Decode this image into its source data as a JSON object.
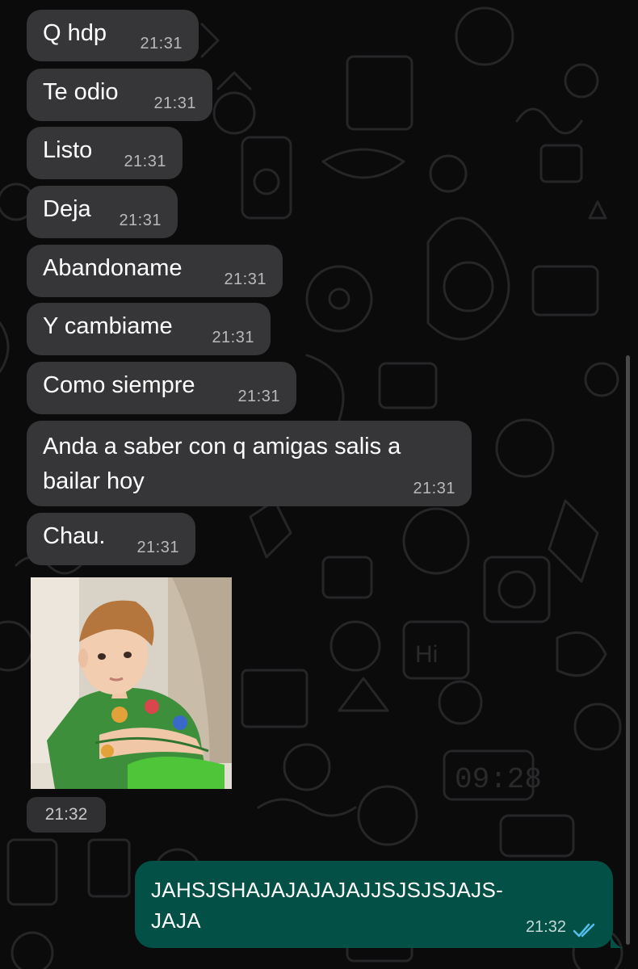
{
  "chat": {
    "incoming": [
      {
        "text": "Q hdp",
        "time": "21:31"
      },
      {
        "text": "Te odio",
        "time": "21:31"
      },
      {
        "text": "Listo",
        "time": "21:31"
      },
      {
        "text": "Deja",
        "time": "21:31"
      },
      {
        "text": "Abandoname",
        "time": "21:31"
      },
      {
        "text": "Y cambiame",
        "time": "21:31"
      },
      {
        "text": "Como siempre",
        "time": "21:31"
      },
      {
        "text": "Anda a saber con q amigas salis a bailar hoy",
        "time": "21:31"
      },
      {
        "text": "Chau.",
        "time": "21:31"
      }
    ],
    "image_message": {
      "time": "21:32"
    },
    "outgoing": {
      "text_line1": "JAHSJSHAJAJAJAJAJJSJSJSJAJS-",
      "text_line2": "JAJA",
      "time": "21:32"
    }
  },
  "wallpaper": {
    "clock_text": "09:28",
    "hi_text": "Hi"
  },
  "colors": {
    "background": "#0b0b0b",
    "incoming_bubble": "#363638",
    "outgoing_bubble": "#035046",
    "read_ticks": "#53bdeb"
  }
}
